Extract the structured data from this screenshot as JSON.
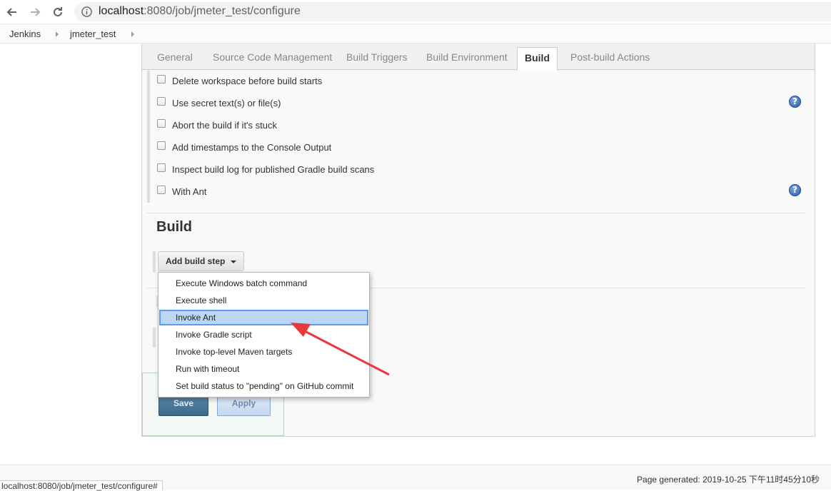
{
  "browser": {
    "url_host": "localhost",
    "url_rest": ":8080/job/jmeter_test/configure"
  },
  "breadcrumb": [
    "Jenkins",
    "jmeter_test"
  ],
  "tabs": [
    {
      "label": "General",
      "active": false
    },
    {
      "label": "Source Code Management",
      "active": false
    },
    {
      "label": "Build Triggers",
      "active": false
    },
    {
      "label": "Build Environment",
      "active": false
    },
    {
      "label": "Build",
      "active": true
    },
    {
      "label": "Post-build Actions",
      "active": false
    }
  ],
  "build_environment_options": [
    {
      "label": "Delete workspace before build starts",
      "checked": false,
      "help": false
    },
    {
      "label": "Use secret text(s) or file(s)",
      "checked": false,
      "help": true
    },
    {
      "label": "Abort the build if it's stuck",
      "checked": false,
      "help": false
    },
    {
      "label": "Add timestamps to the Console Output",
      "checked": false,
      "help": false
    },
    {
      "label": "Inspect build log for published Gradle build scans",
      "checked": false,
      "help": false
    },
    {
      "label": "With Ant",
      "checked": false,
      "help": true
    }
  ],
  "build_section": {
    "title": "Build",
    "add_step_label": "Add build step"
  },
  "build_step_menu": {
    "items": [
      "Execute Windows batch command",
      "Execute shell",
      "Invoke Ant",
      "Invoke Gradle script",
      "Invoke top-level Maven targets",
      "Run with timeout",
      "Set build status to \"pending\" on GitHub commit"
    ],
    "highlighted": "Invoke Ant"
  },
  "buttons": {
    "save": "Save",
    "apply": "Apply"
  },
  "footer": {
    "page_generated": "Page generated: 2019-10-25 下午11时45分10秒"
  },
  "status_bar_url": "localhost:8080/job/jmeter_test/configure#",
  "colors": {
    "menu_highlight": "#bcd6f5",
    "annotation_arrow": "#e8383d",
    "save_button": "#3d6b8a"
  }
}
